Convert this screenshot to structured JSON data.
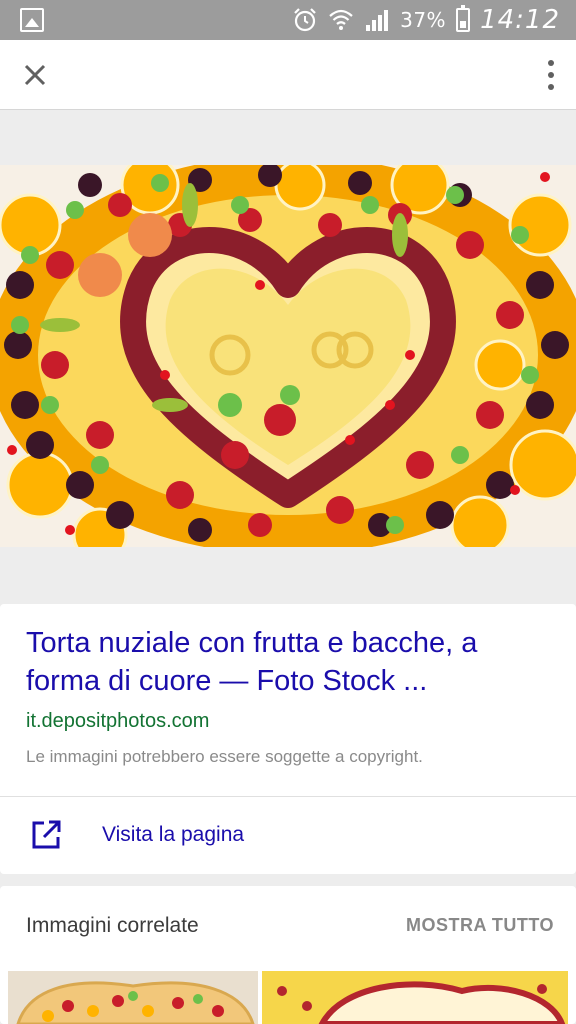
{
  "status_bar": {
    "battery": "37%",
    "time": "14:12",
    "icons": [
      "gallery-notification-icon",
      "alarm-icon",
      "wifi-icon",
      "signal-icon",
      "battery-icon"
    ]
  },
  "toolbar": {
    "close_icon": "close-icon",
    "more_icon": "more-vert-icon"
  },
  "result": {
    "title": "Torta nuziale con frutta e bacche, a forma di cuore — Foto Stock ...",
    "domain": "it.depositphotos.com",
    "copyright_note": "Le immagini potrebbero essere soggette a copyright.",
    "visit_label": "Visita la pagina",
    "visit_icon": "open-in-new-icon"
  },
  "related": {
    "title": "Immagini correlate",
    "show_all": "MOSTRA TUTTO"
  },
  "colors": {
    "status_bar": "#9c9c9c",
    "link": "#1a0dab",
    "domain": "#137333",
    "background": "#ededed"
  }
}
